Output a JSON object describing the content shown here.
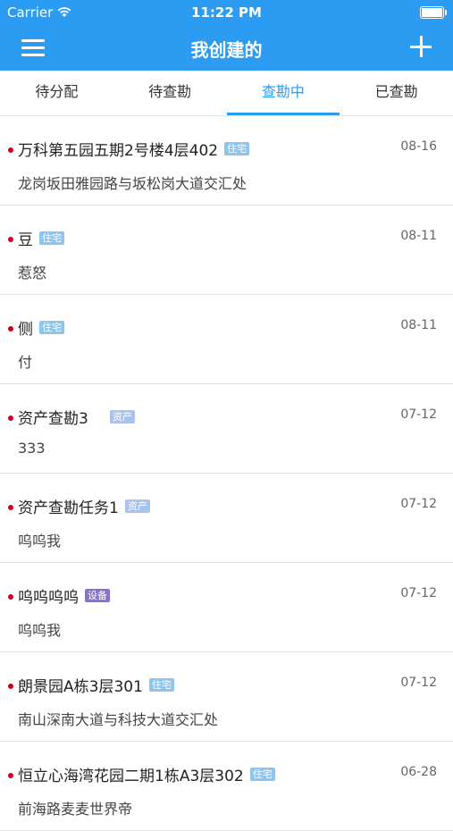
{
  "status": {
    "carrier": "Carrier",
    "time": "11:22 PM"
  },
  "nav": {
    "title": "我创建的"
  },
  "tabs": [
    "待分配",
    "待查勘",
    "查勘中",
    "已查勘"
  ],
  "active_tab": 2,
  "items": [
    {
      "title": "万科第五园五期2号楼4层402",
      "tag": "住宅",
      "tag_type": "res",
      "subtitle": "龙岗坂田雅园路与坂松岗大道交汇处",
      "date": "08-16"
    },
    {
      "title": "豆",
      "tag": "住宅",
      "tag_type": "res",
      "subtitle": "惹怒",
      "date": "08-11"
    },
    {
      "title": "侧",
      "tag": "住宅",
      "tag_type": "res",
      "subtitle": "付",
      "date": "08-11"
    },
    {
      "title": "资产查勘3",
      "tag": "资产",
      "tag_type": "asset",
      "subtitle": "333",
      "date": "07-12"
    },
    {
      "title": "资产查勘任务1",
      "tag": "资产",
      "tag_type": "asset",
      "subtitle": "呜呜我",
      "date": "07-12"
    },
    {
      "title": "呜呜呜呜",
      "tag": "设备",
      "tag_type": "equip",
      "subtitle": "呜呜我",
      "date": "07-12"
    },
    {
      "title": "朗景园A栋3层301",
      "tag": "住宅",
      "tag_type": "res",
      "subtitle": "南山深南大道与科技大道交汇处",
      "date": "07-12"
    },
    {
      "title": "恒立心海湾花园二期1栋A3层302",
      "tag": "住宅",
      "tag_type": "res",
      "subtitle": "前海路麦麦世界帝",
      "date": "06-28"
    }
  ]
}
